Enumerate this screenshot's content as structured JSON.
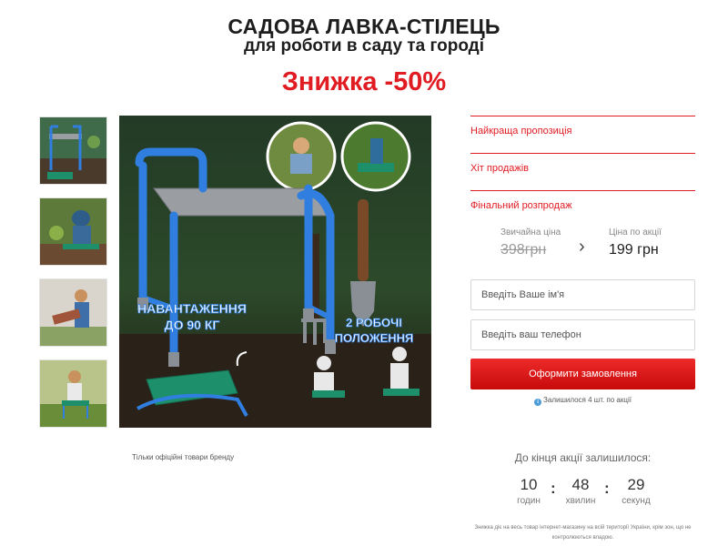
{
  "header": {
    "title_line1": "САДОВА ЛАВКА-СТІЛЕЦЬ",
    "title_line2": "для роботи в саду та городі",
    "discount": "Знижка -50%"
  },
  "gallery": {
    "thumbnails": [
      "thumbnail-1",
      "thumbnail-2",
      "thumbnail-3",
      "thumbnail-4"
    ],
    "main_image": {
      "badge_load": [
        "НАВАНТАЖЕННЯ",
        "ДО 90 КГ"
      ],
      "badge_positions": [
        "2 РОБОЧІ",
        "ПОЛОЖЕННЯ"
      ]
    },
    "brand_note": "Тільки офіційні товари бренду"
  },
  "offers": [
    "Найкраща пропозиція",
    "Хіт продажів",
    "Фінальний розпродаж"
  ],
  "price": {
    "old_label": "Звичайна ціна",
    "old_value": "398грн",
    "arrow_icon": "chevron-right-icon",
    "new_label": "Ціна по акції",
    "new_value": "199 грн"
  },
  "form": {
    "name_placeholder": "Введіть Ваше ім'я",
    "phone_placeholder": "Введіть ваш телефон",
    "submit_label": "Оформити замовлення"
  },
  "stock_note": "Залишилося 4 шт. по акції",
  "countdown": {
    "title": "До кінця акції залишилося:",
    "hours": "10",
    "hours_label": "годин",
    "minutes": "48",
    "minutes_label": "хвилин",
    "seconds": "29",
    "seconds_label": "секунд",
    "separator": ":"
  },
  "disclaimer": "Знижка діє на весь товар інтернет-магазину на всій території України, крім зон, що не контролюються владою.",
  "colors": {
    "accent": "#e01b22",
    "frame_blue": "#2f7ee0",
    "seat_gray": "#9a9ea2",
    "kneeler_green": "#1d8f6a"
  }
}
